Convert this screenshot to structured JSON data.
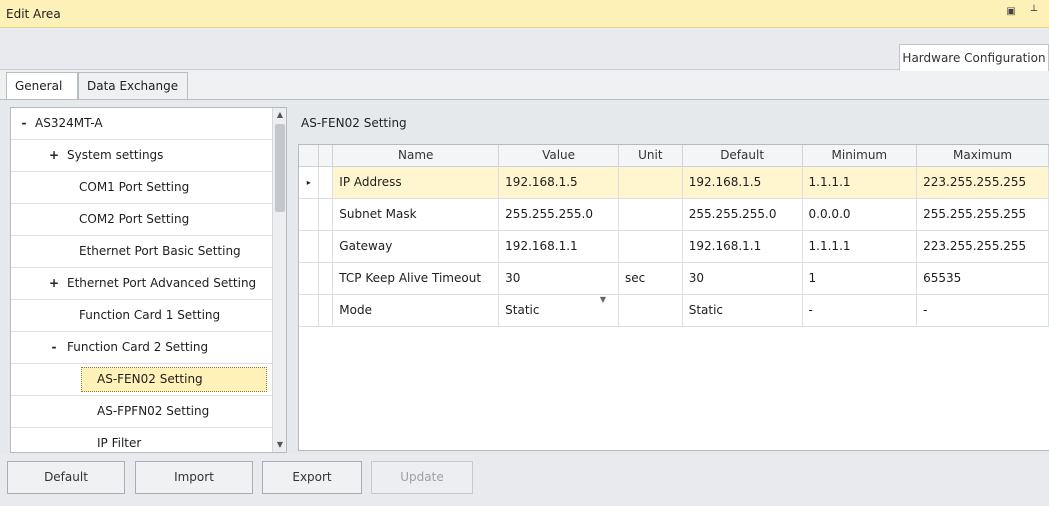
{
  "window": {
    "title": "Edit Area",
    "controls": "▣ ┴"
  },
  "top_tab": {
    "label": "Hardware Configuration"
  },
  "tabs": [
    {
      "label": "General",
      "active": true
    },
    {
      "label": "Data Exchange",
      "active": false
    }
  ],
  "tree": {
    "items": [
      {
        "label": "AS324MT-A",
        "expander": "-",
        "level": 0,
        "selected": false
      },
      {
        "label": "System settings",
        "expander": "+",
        "level": 1,
        "selected": false
      },
      {
        "label": "COM1 Port Setting",
        "expander": "",
        "level": 1,
        "selected": false
      },
      {
        "label": "COM2 Port Setting",
        "expander": "",
        "level": 1,
        "selected": false
      },
      {
        "label": "Ethernet Port Basic Setting",
        "expander": "",
        "level": 1,
        "selected": false
      },
      {
        "label": "Ethernet Port Advanced Setting",
        "expander": "+",
        "level": 1,
        "selected": false
      },
      {
        "label": "Function Card 1 Setting",
        "expander": "",
        "level": 1,
        "selected": false
      },
      {
        "label": "Function Card 2 Setting",
        "expander": "-",
        "level": 1,
        "selected": false
      },
      {
        "label": "AS-FEN02 Setting",
        "expander": "",
        "level": 2,
        "selected": true
      },
      {
        "label": "AS-FPFN02 Setting",
        "expander": "",
        "level": 2,
        "selected": false
      },
      {
        "label": "IP Filter",
        "expander": "",
        "level": 2,
        "selected": false
      }
    ]
  },
  "setting": {
    "title": "AS-FEN02 Setting",
    "columns": [
      "Name",
      "Value",
      "Unit",
      "Default",
      "Minimum",
      "Maximum"
    ],
    "rows": [
      {
        "name": "IP Address",
        "value": "192.168.1.5",
        "unit": "",
        "default": "192.168.1.5",
        "minimum": "1.1.1.1",
        "maximum": "223.255.255.255",
        "current": true
      },
      {
        "name": "Subnet Mask",
        "value": "255.255.255.0",
        "unit": "",
        "default": "255.255.255.0",
        "minimum": "0.0.0.0",
        "maximum": "255.255.255.255",
        "current": false
      },
      {
        "name": "Gateway",
        "value": "192.168.1.1",
        "unit": "",
        "default": "192.168.1.1",
        "minimum": "1.1.1.1",
        "maximum": "223.255.255.255",
        "current": false
      },
      {
        "name": "TCP Keep Alive Timeout",
        "value": "30",
        "unit": "sec",
        "default": "30",
        "minimum": "1",
        "maximum": "65535",
        "current": false
      },
      {
        "name": "Mode",
        "value": "Static",
        "unit": "",
        "default": "Static",
        "minimum": "-",
        "maximum": "-",
        "current": false,
        "dropdown": true
      }
    ],
    "current_row_marker": "▸"
  },
  "buttons": {
    "default": "Default",
    "import": "Import",
    "export": "Export",
    "update": "Update"
  },
  "colors": {
    "title_bar": "#fdf1b8",
    "selection": "#fff1b8"
  }
}
